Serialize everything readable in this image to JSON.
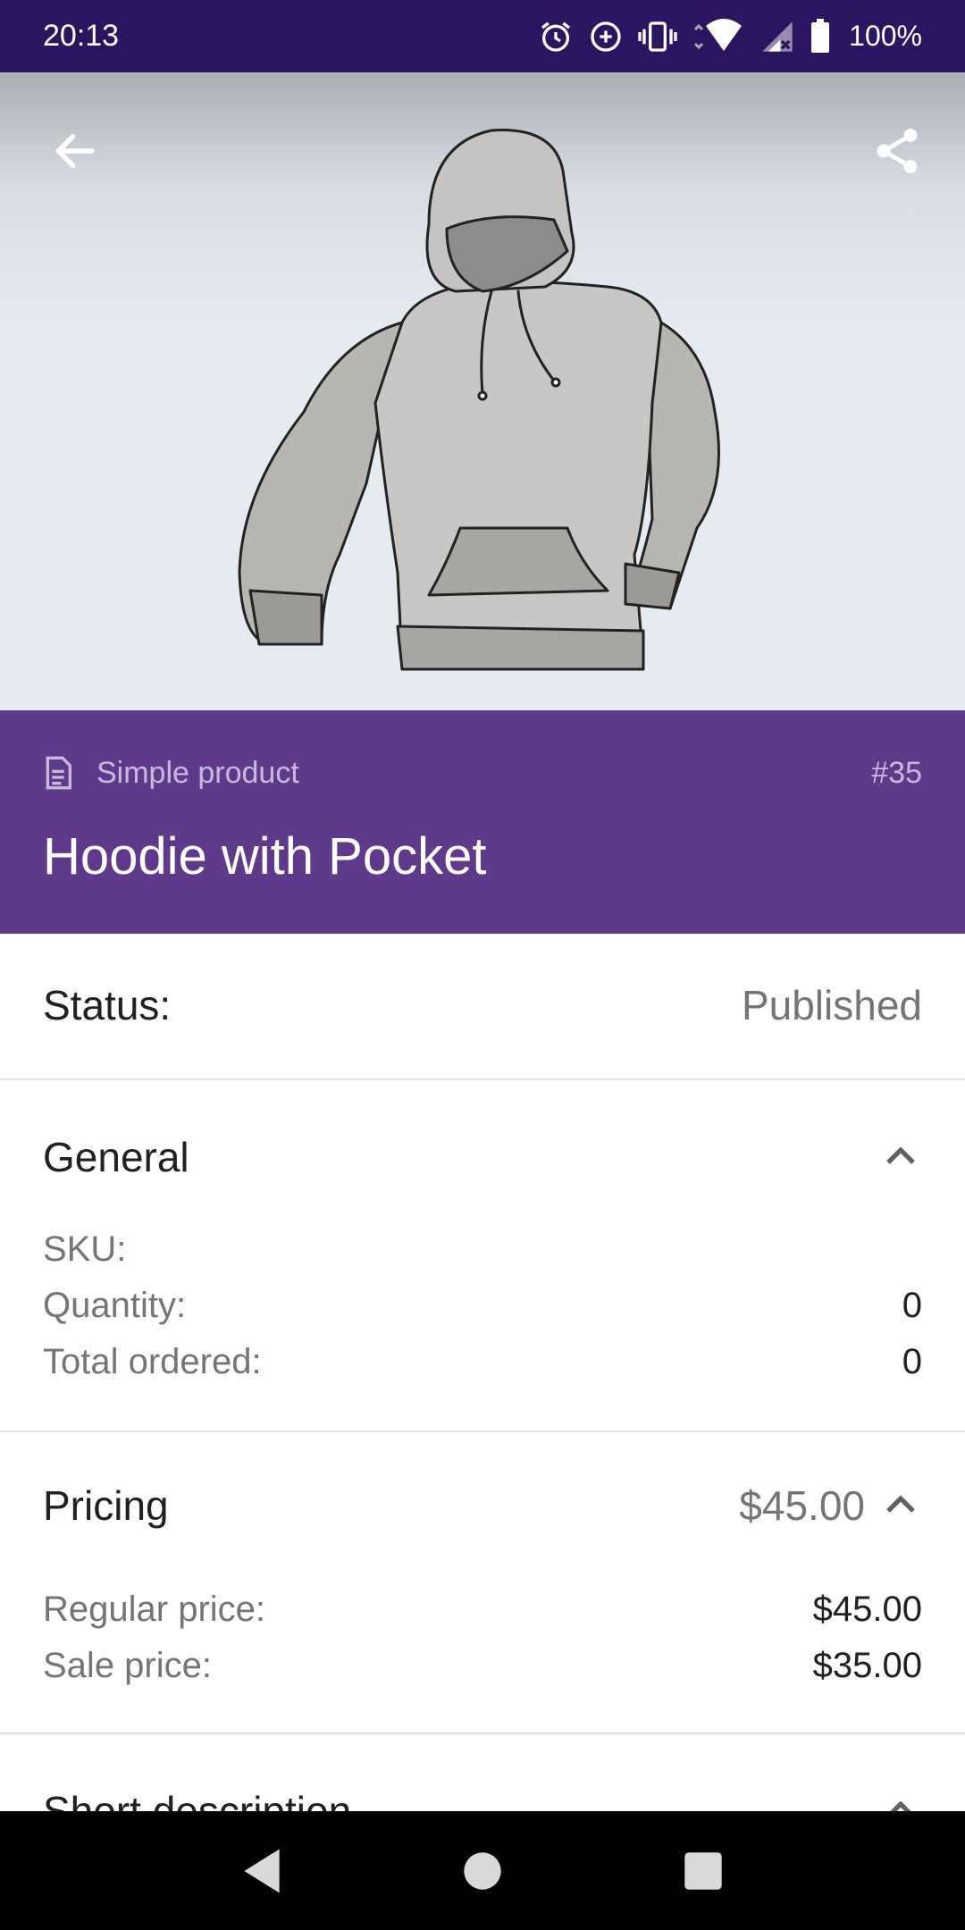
{
  "status_bar": {
    "time": "20:13",
    "battery": "100%",
    "icons": [
      "alarm-icon",
      "data-saver-icon",
      "vibrate-icon",
      "wifi-icon",
      "signal-icon",
      "battery-icon"
    ]
  },
  "hero": {
    "image": "hoodie-illustration",
    "back_icon": "arrow-back-icon",
    "share_icon": "share-icon"
  },
  "header": {
    "product_type": "Simple product",
    "product_id": "#35",
    "title": "Hoodie with Pocket"
  },
  "status": {
    "label": "Status:",
    "value": "Published"
  },
  "general": {
    "title": "General",
    "rows": [
      {
        "label": "SKU:",
        "value": ""
      },
      {
        "label": "Quantity:",
        "value": "0"
      },
      {
        "label": "Total ordered:",
        "value": "0"
      }
    ]
  },
  "pricing": {
    "title": "Pricing",
    "summary": "$45.00",
    "rows": [
      {
        "label": "Regular price:",
        "value": "$45.00"
      },
      {
        "label": "Sale price:",
        "value": "$35.00"
      }
    ]
  },
  "short_description": {
    "title": "Short description"
  },
  "colors": {
    "status_bar": "#2c1560",
    "header": "#5f3a8b",
    "muted_text": "#757575"
  }
}
